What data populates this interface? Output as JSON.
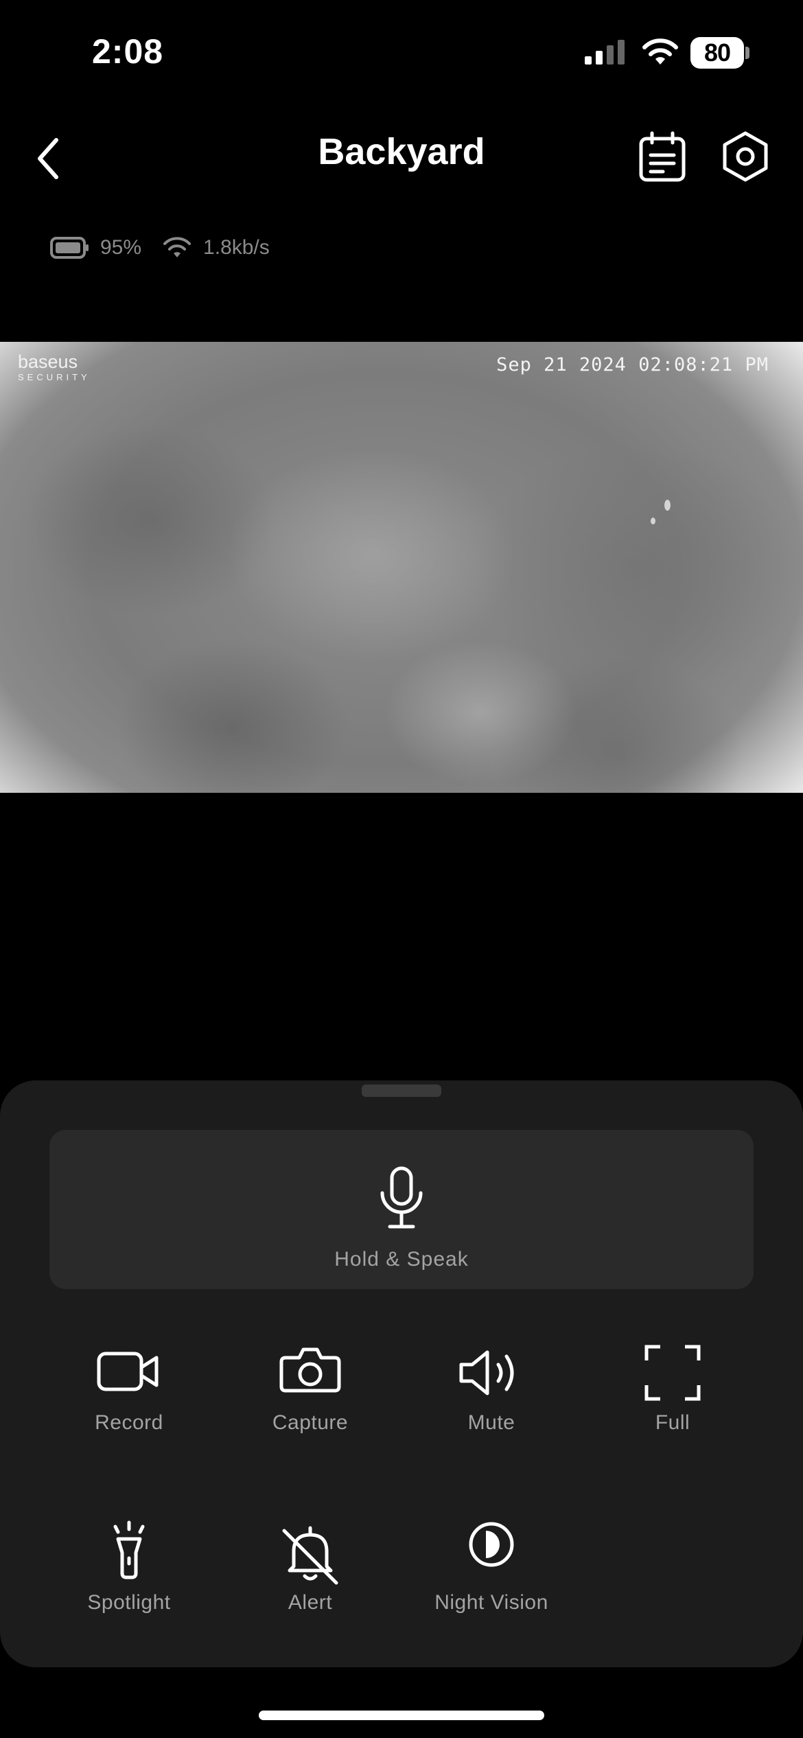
{
  "status_bar": {
    "time": "2:08",
    "battery_level": "80"
  },
  "header": {
    "title": "Backyard"
  },
  "device_info": {
    "battery": "95%",
    "bitrate": "1.8kb/s"
  },
  "camera_feed": {
    "logo_name": "baseus",
    "logo_sub": "SECURITY",
    "timestamp": "Sep 21 2024 02:08:21 PM"
  },
  "controls": {
    "hold_to_speak": "Hold & Speak",
    "record": "Record",
    "capture": "Capture",
    "mute": "Mute",
    "full": "Full",
    "spotlight": "Spotlight",
    "alert": "Alert",
    "night_vision": "Night Vision"
  },
  "icons": {
    "back": "chevron-left-icon",
    "calendar": "calendar-icon",
    "settings": "hexagon-gear-icon",
    "microphone": "microphone-icon",
    "record": "video-camera-icon",
    "capture": "camera-icon",
    "mute": "speaker-icon",
    "full": "fullscreen-icon",
    "spotlight": "flashlight-icon",
    "alert": "bell-off-icon",
    "night_vision": "night-vision-icon"
  }
}
